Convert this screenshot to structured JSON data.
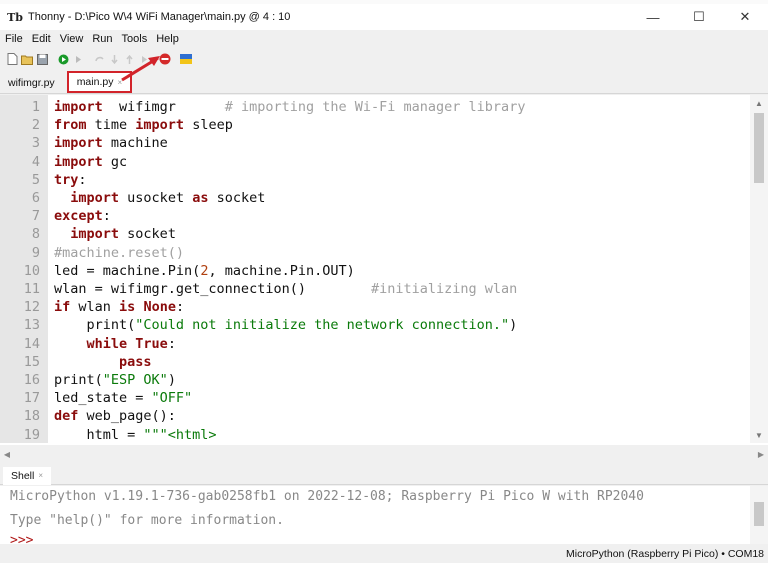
{
  "window": {
    "title": "Thonny  -  D:\\Pico W\\4 WiFi Manager\\main.py  @  4 : 10",
    "app_icon_glyph": "Tb",
    "minimize_glyph": "—",
    "maximize_glyph": "☐",
    "close_glyph": "✕"
  },
  "menu": [
    "File",
    "Edit",
    "View",
    "Run",
    "Tools",
    "Help"
  ],
  "toolbar": {
    "icons": [
      "new-file-icon",
      "open-file-icon",
      "save-icon",
      "run-icon",
      "debug-icon",
      "step-over-icon",
      "step-into-icon",
      "step-out-icon",
      "resume-icon",
      "stop-icon",
      "ukraine-flag-icon"
    ],
    "colors": {
      "run": "#1a9a2a",
      "stop": "#d42a2a",
      "flag_top": "#2f6fd1",
      "flag_bottom": "#f2c418"
    }
  },
  "tabs": [
    {
      "label": "wifimgr.py",
      "active": false,
      "close": ""
    },
    {
      "label": "main.py",
      "active": true,
      "close": "×"
    }
  ],
  "editor": {
    "lines": [
      {
        "n": "1",
        "segs": [
          [
            "kw",
            "import"
          ],
          [
            "",
            "  wifimgr"
          ],
          [
            "",
            "      "
          ],
          [
            "cmt",
            "# importing the Wi-Fi manager library"
          ]
        ]
      },
      {
        "n": "2",
        "segs": [
          [
            "kw",
            "from"
          ],
          [
            "",
            " time "
          ],
          [
            "kw",
            "import"
          ],
          [
            "",
            " sleep"
          ]
        ]
      },
      {
        "n": "3",
        "segs": [
          [
            "kw",
            "import"
          ],
          [
            "",
            " machine"
          ]
        ]
      },
      {
        "n": "4",
        "segs": [
          [
            "kw",
            "import"
          ],
          [
            "",
            " gc"
          ]
        ]
      },
      {
        "n": "5",
        "segs": [
          [
            "kw",
            "try"
          ],
          [
            "",
            ":"
          ]
        ]
      },
      {
        "n": "6",
        "segs": [
          [
            "",
            "  "
          ],
          [
            "kw",
            "import"
          ],
          [
            "",
            " usocket "
          ],
          [
            "kw",
            "as"
          ],
          [
            "",
            " socket"
          ]
        ]
      },
      {
        "n": "7",
        "segs": [
          [
            "kw",
            "except"
          ],
          [
            "",
            ":"
          ]
        ]
      },
      {
        "n": "8",
        "segs": [
          [
            "",
            "  "
          ],
          [
            "kw",
            "import"
          ],
          [
            "",
            " socket"
          ]
        ]
      },
      {
        "n": "9",
        "segs": [
          [
            "cmt",
            "#machine.reset()"
          ]
        ]
      },
      {
        "n": "10",
        "segs": [
          [
            "",
            "led = machine.Pin("
          ],
          [
            "num",
            "2"
          ],
          [
            "",
            ", machine.Pin.OUT)"
          ]
        ]
      },
      {
        "n": "11",
        "segs": [
          [
            "",
            "wlan = wifimgr.get_connection()"
          ],
          [
            "",
            "        "
          ],
          [
            "cmt",
            "#initializing wlan"
          ]
        ]
      },
      {
        "n": "12",
        "segs": [
          [
            "kw",
            "if"
          ],
          [
            "",
            " wlan "
          ],
          [
            "kw",
            "is"
          ],
          [
            "",
            " "
          ],
          [
            "kw",
            "None"
          ],
          [
            "",
            ":"
          ]
        ]
      },
      {
        "n": "13",
        "segs": [
          [
            "",
            "    print("
          ],
          [
            "str",
            "\"Could not initialize the network connection.\""
          ],
          [
            "",
            ")"
          ]
        ]
      },
      {
        "n": "14",
        "segs": [
          [
            "",
            "    "
          ],
          [
            "kw",
            "while"
          ],
          [
            "",
            " "
          ],
          [
            "kw",
            "True"
          ],
          [
            "",
            ":"
          ]
        ]
      },
      {
        "n": "15",
        "segs": [
          [
            "",
            "        "
          ],
          [
            "kw",
            "pass"
          ]
        ]
      },
      {
        "n": "16",
        "segs": [
          [
            "",
            "print("
          ],
          [
            "str",
            "\"ESP OK\""
          ],
          [
            "",
            ")"
          ]
        ]
      },
      {
        "n": "17",
        "segs": [
          [
            "",
            "led_state = "
          ],
          [
            "str",
            "\"OFF\""
          ]
        ]
      },
      {
        "n": "18",
        "segs": [
          [
            "kw",
            "def"
          ],
          [
            "",
            " web_page():"
          ]
        ]
      },
      {
        "n": "19",
        "segs": [
          [
            "",
            "    html = "
          ],
          [
            "str",
            "\"\"\"<html>"
          ]
        ]
      }
    ]
  },
  "shell": {
    "tab_label": "Shell",
    "tab_close": "×",
    "lines": [
      "MicroPython v1.19.1-736-gab0258fb1 on 2022-12-08; Raspberry Pi Pico W with RP2040",
      "Type \"help()\" for more information.",
      ">>> "
    ]
  },
  "status": {
    "text": "MicroPython (Raspberry Pi Pico)  •  COM18"
  },
  "annotation": {
    "color": "#d2232a"
  }
}
